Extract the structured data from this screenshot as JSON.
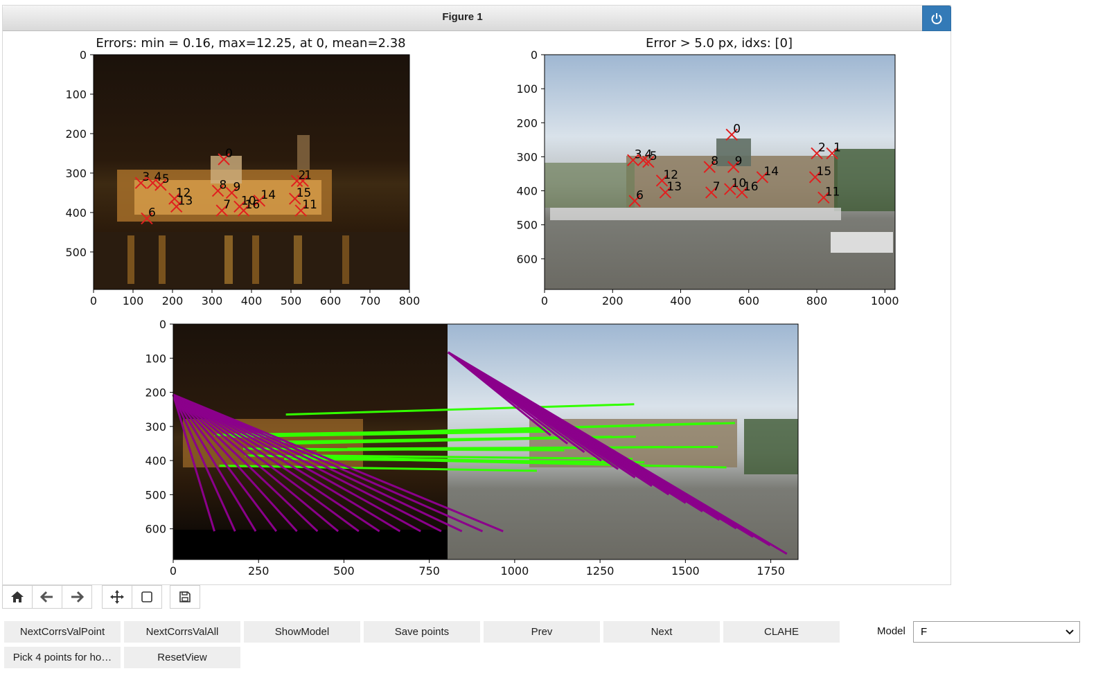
{
  "window": {
    "title": "Figure 1"
  },
  "plots": {
    "top_left": {
      "title": "Errors: min = 0.16, max=12.25, at 0, mean=2.38",
      "xticks": [
        "0",
        "100",
        "200",
        "300",
        "400",
        "500",
        "600",
        "700",
        "800"
      ],
      "yticks": [
        "0",
        "100",
        "200",
        "300",
        "400",
        "500"
      ],
      "points": [
        {
          "label": "0",
          "x": 330,
          "y": 265
        },
        {
          "label": "1",
          "x": 530,
          "y": 320
        },
        {
          "label": "2",
          "x": 515,
          "y": 320
        },
        {
          "label": "3",
          "x": 120,
          "y": 325
        },
        {
          "label": "4",
          "x": 150,
          "y": 325
        },
        {
          "label": "5",
          "x": 170,
          "y": 330
        },
        {
          "label": "6",
          "x": 135,
          "y": 415
        },
        {
          "label": "7",
          "x": 325,
          "y": 395
        },
        {
          "label": "8",
          "x": 315,
          "y": 345
        },
        {
          "label": "9",
          "x": 350,
          "y": 350
        },
        {
          "label": "10",
          "x": 370,
          "y": 385
        },
        {
          "label": "11",
          "x": 525,
          "y": 395
        },
        {
          "label": "12",
          "x": 205,
          "y": 365
        },
        {
          "label": "13",
          "x": 210,
          "y": 385
        },
        {
          "label": "14",
          "x": 420,
          "y": 370
        },
        {
          "label": "15",
          "x": 510,
          "y": 365
        },
        {
          "label": "16",
          "x": 380,
          "y": 395
        }
      ]
    },
    "top_right": {
      "title": "Error > 5.0 px, idxs: [0]",
      "xticks": [
        "0",
        "200",
        "400",
        "600",
        "800",
        "1000"
      ],
      "yticks": [
        "0",
        "100",
        "200",
        "300",
        "400",
        "500",
        "600"
      ],
      "points": [
        {
          "label": "0",
          "x": 550,
          "y": 235
        },
        {
          "label": "1",
          "x": 845,
          "y": 290
        },
        {
          "label": "2",
          "x": 800,
          "y": 290
        },
        {
          "label": "3",
          "x": 260,
          "y": 310
        },
        {
          "label": "4",
          "x": 290,
          "y": 310
        },
        {
          "label": "5",
          "x": 305,
          "y": 315
        },
        {
          "label": "6",
          "x": 265,
          "y": 430
        },
        {
          "label": "7",
          "x": 490,
          "y": 405
        },
        {
          "label": "8",
          "x": 485,
          "y": 330
        },
        {
          "label": "9",
          "x": 555,
          "y": 330
        },
        {
          "label": "10",
          "x": 545,
          "y": 395
        },
        {
          "label": "11",
          "x": 820,
          "y": 420
        },
        {
          "label": "12",
          "x": 345,
          "y": 370
        },
        {
          "label": "13",
          "x": 355,
          "y": 405
        },
        {
          "label": "14",
          "x": 640,
          "y": 360
        },
        {
          "label": "15",
          "x": 795,
          "y": 360
        },
        {
          "label": "16",
          "x": 580,
          "y": 405
        }
      ]
    },
    "bottom": {
      "xticks": [
        "0",
        "250",
        "500",
        "750",
        "1000",
        "1250",
        "1500",
        "1750"
      ],
      "yticks": [
        "0",
        "100",
        "200",
        "300",
        "400",
        "500",
        "600"
      ]
    }
  },
  "toolbar": {
    "icons": [
      "home-icon",
      "back-arrow-icon",
      "forward-arrow-icon",
      "move-icon",
      "zoom-rect-icon",
      "save-icon"
    ]
  },
  "buttons": {
    "row1": [
      "NextCorrsValPoint",
      "NextCorrsValAll",
      "ShowModel",
      "Save points",
      "Prev",
      "Next",
      "CLAHE"
    ],
    "row2": [
      "Pick 4 points for ho…",
      "ResetView"
    ]
  },
  "model": {
    "label": "Model",
    "value": "F"
  },
  "colors": {
    "marker": "#e11f1f",
    "inlier_line": "#33ff00",
    "outlier_line": "#8b008b",
    "power_button": "#337ab7"
  }
}
